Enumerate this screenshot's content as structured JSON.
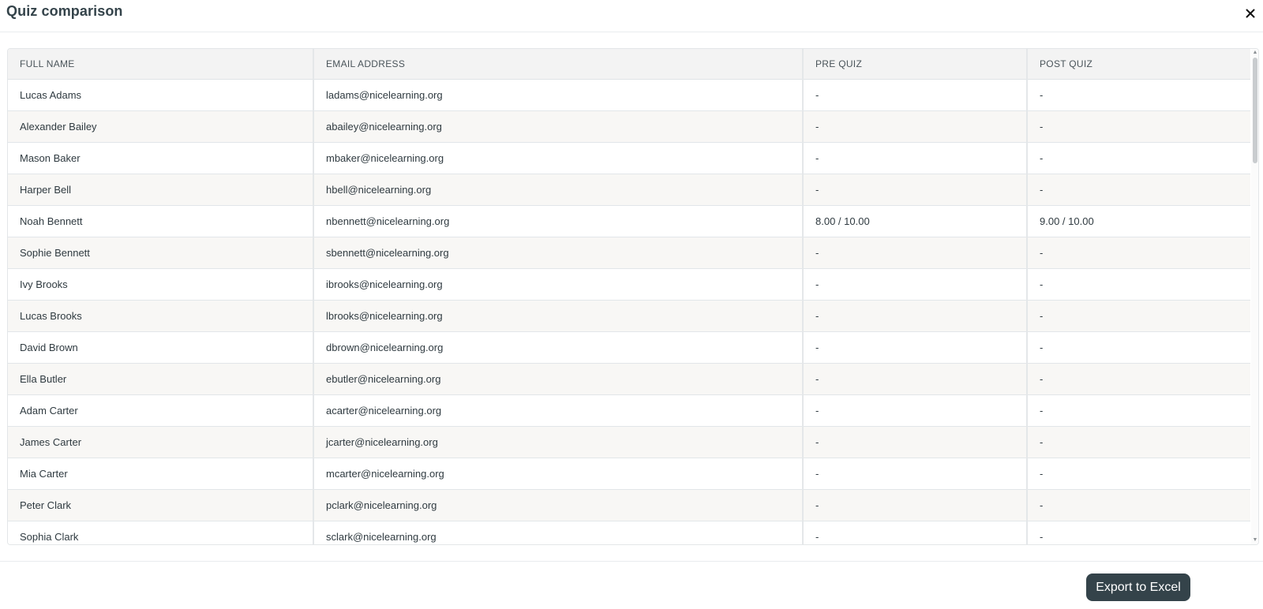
{
  "modal": {
    "title": "Quiz comparison",
    "close_icon": "close-icon"
  },
  "table": {
    "columns": [
      "FULL NAME",
      "EMAIL ADDRESS",
      "PRE QUIZ",
      "POST QUIZ"
    ],
    "rows": [
      [
        "Lucas Adams",
        "ladams@nicelearning.org",
        "-",
        "-"
      ],
      [
        "Alexander Bailey",
        "abailey@nicelearning.org",
        "-",
        "-"
      ],
      [
        "Mason Baker",
        "mbaker@nicelearning.org",
        "-",
        "-"
      ],
      [
        "Harper Bell",
        "hbell@nicelearning.org",
        "-",
        "-"
      ],
      [
        "Noah Bennett",
        "nbennett@nicelearning.org",
        "8.00 / 10.00",
        "9.00 / 10.00"
      ],
      [
        "Sophie Bennett",
        "sbennett@nicelearning.org",
        "-",
        "-"
      ],
      [
        "Ivy Brooks",
        "ibrooks@nicelearning.org",
        "-",
        "-"
      ],
      [
        "Lucas Brooks",
        "lbrooks@nicelearning.org",
        "-",
        "-"
      ],
      [
        "David Brown",
        "dbrown@nicelearning.org",
        "-",
        "-"
      ],
      [
        "Ella Butler",
        "ebutler@nicelearning.org",
        "-",
        "-"
      ],
      [
        "Adam Carter",
        "acarter@nicelearning.org",
        "-",
        "-"
      ],
      [
        "James Carter",
        "jcarter@nicelearning.org",
        "-",
        "-"
      ],
      [
        "Mia Carter",
        "mcarter@nicelearning.org",
        "-",
        "-"
      ],
      [
        "Peter Clark",
        "pclark@nicelearning.org",
        "-",
        "-"
      ],
      [
        "Sophia Clark",
        "sclark@nicelearning.org",
        "-",
        "-"
      ]
    ]
  },
  "footer": {
    "export_label": "Export to Excel"
  },
  "colors": {
    "primary": "#34434a",
    "header_bg": "#f3f3f3",
    "stripe_bg": "#f8f7f5"
  }
}
